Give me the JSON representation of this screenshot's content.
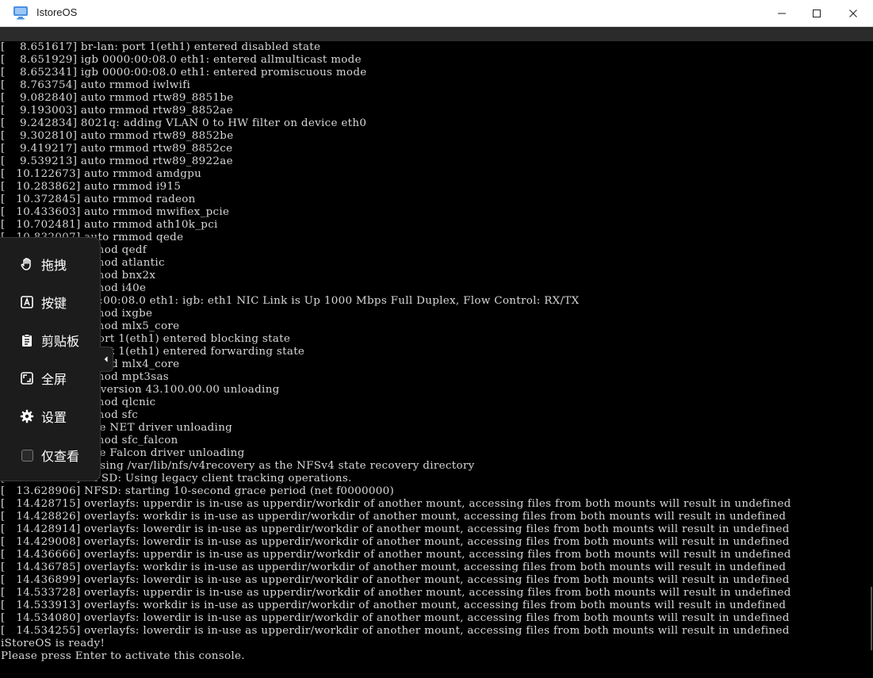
{
  "window": {
    "title": "IstoreOS",
    "icon": "monitor-app-icon",
    "controls": [
      "minimize-icon",
      "maximize-icon",
      "close-icon"
    ]
  },
  "console": {
    "lines": [
      "[    8.651617] br-lan: port 1(eth1) entered disabled state",
      "[    8.651929] igb 0000:00:08.0 eth1: entered allmulticast mode",
      "[    8.652341] igb 0000:00:08.0 eth1: entered promiscuous mode",
      "[    8.763754] auto rmmod iwlwifi",
      "[    9.082840] auto rmmod rtw89_8851be",
      "[    9.193003] auto rmmod rtw89_8852ae",
      "[    9.242834] 8021q: adding VLAN 0 to HW filter on device eth0",
      "[    9.302810] auto rmmod rtw89_8852be",
      "[    9.419217] auto rmmod rtw89_8852ce",
      "[    9.539213] auto rmmod rtw89_8922ae",
      "[   10.122673] auto rmmod amdgpu",
      "[   10.283862] auto rmmod i915",
      "[   10.372845] auto rmmod radeon",
      "[   10.433603] auto rmmod mwifiex_pcie",
      "[   10.702481] auto rmmod ath10k_pci",
      "[   10.832007] auto rmmod qede",
      "[          ] auto rmmod qedf",
      "[          ] auto rmmod atlantic",
      "[          ] auto rmmod bnx2x",
      "[          ] auto rmmod i40e",
      "[          ] igb 0000:00:08.0 eth1: igb: eth1 NIC Link is Up 1000 Mbps Full Duplex, Flow Control: RX/TX",
      "[          ] auto rmmod ixgbe",
      "[          ] auto rmmod mlx5_core",
      "[          ] br-lan: port 1(eth1) entered blocking state",
      "[          ] br-lan: port 1(eth1) entered forwarding state",
      "[          ] auto rmmod mlx4_core",
      "[          ] auto rmmod mpt3sas",
      "[          ] mpt3sas version 43.100.00.00 unloading",
      "[          ] auto rmmod qlcnic",
      "[          ] auto rmmod sfc",
      "[          ] Solarflare NET driver unloading",
      "[          ] auto rmmod sfc_falcon",
      "[          ] Solarflare Falcon driver unloading",
      "[          ] NFSD: Using /var/lib/nfs/v4recovery as the NFSv4 state recovery directory",
      "[   13.628882] NFSD: Using legacy client tracking operations.",
      "[   13.628906] NFSD: starting 10-second grace period (net f0000000)",
      "[   14.428715] overlayfs: upperdir is in-use as upperdir/workdir of another mount, accessing files from both mounts will result in undefined",
      "[   14.428826] overlayfs: workdir is in-use as upperdir/workdir of another mount, accessing files from both mounts will result in undefined",
      "[   14.428914] overlayfs: lowerdir is in-use as upperdir/workdir of another mount, accessing files from both mounts will result in undefined",
      "[   14.429008] overlayfs: lowerdir is in-use as upperdir/workdir of another mount, accessing files from both mounts will result in undefined",
      "[   14.436666] overlayfs: upperdir is in-use as upperdir/workdir of another mount, accessing files from both mounts will result in undefined",
      "[   14.436785] overlayfs: workdir is in-use as upperdir/workdir of another mount, accessing files from both mounts will result in undefined",
      "[   14.436899] overlayfs: lowerdir is in-use as upperdir/workdir of another mount, accessing files from both mounts will result in undefined",
      "[   14.533728] overlayfs: upperdir is in-use as upperdir/workdir of another mount, accessing files from both mounts will result in undefined",
      "[   14.533913] overlayfs: workdir is in-use as upperdir/workdir of another mount, accessing files from both mounts will result in undefined",
      "[   14.534080] overlayfs: lowerdir is in-use as upperdir/workdir of another mount, accessing files from both mounts will result in undefined",
      "[   14.534255] overlayfs: lowerdir is in-use as upperdir/workdir of another mount, accessing files from both mounts will result in undefined",
      "iStoreOS is ready!",
      "Please press Enter to activate this console."
    ]
  },
  "sidebar": {
    "items": [
      {
        "label": "拖拽",
        "icon": "hand-drag-icon"
      },
      {
        "label": "按键",
        "icon": "keyboard-key-icon"
      },
      {
        "label": "剪贴板",
        "icon": "clipboard-icon"
      },
      {
        "label": "全屏",
        "icon": "fullscreen-icon"
      },
      {
        "label": "设置",
        "icon": "gear-icon"
      },
      {
        "label": "仅查看",
        "icon": "checkbox"
      }
    ],
    "view_only_checked": false,
    "collapse_icon": "chevron-left-icon"
  }
}
